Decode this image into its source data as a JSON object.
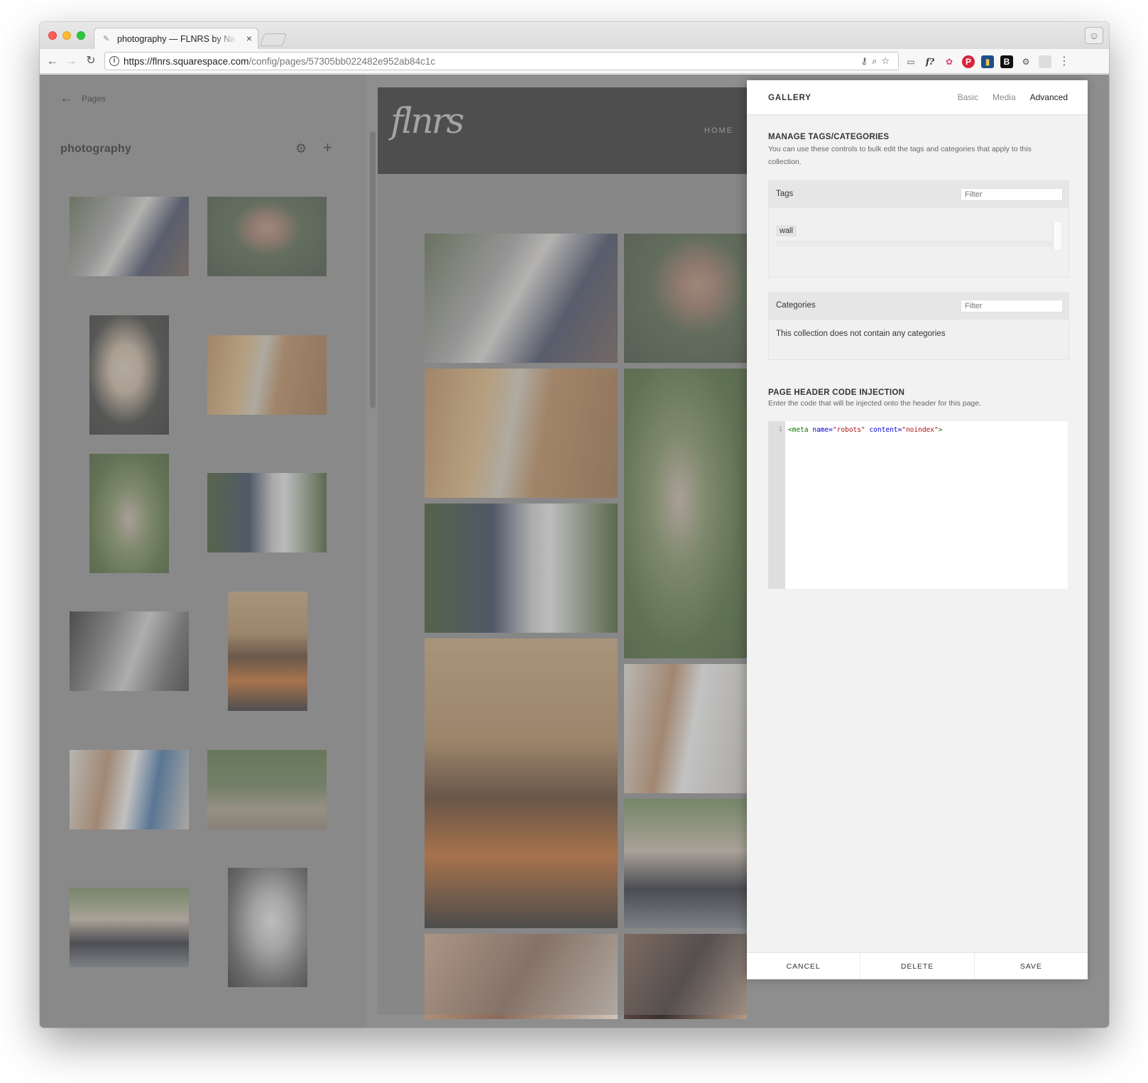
{
  "browser": {
    "tab_title": "photography — FLNRS by Na",
    "url_host": "https://flnrs.squarespace.com",
    "url_path": "/config/pages/57305bb022482e952ab84c1c"
  },
  "left_panel": {
    "back_label": "Pages",
    "title": "photography"
  },
  "preview": {
    "logo_text": "flnrs",
    "nav_home": "HOME"
  },
  "settings": {
    "title": "GALLERY",
    "tabs": [
      "Basic",
      "Media",
      "Advanced"
    ],
    "active_tab": "Advanced",
    "manage": {
      "heading": "MANAGE TAGS/CATEGORIES",
      "description": "You can use these controls to bulk edit the tags and categories that apply to this collection."
    },
    "tags": {
      "label": "Tags",
      "filter_placeholder": "Filter",
      "items": [
        "wall"
      ]
    },
    "categories": {
      "label": "Categories",
      "filter_placeholder": "Filter",
      "empty_text": "This collection does not contain any categories"
    },
    "injection": {
      "heading": "PAGE HEADER CODE INJECTION",
      "description": "Enter the code that will be injected onto the header for this page.",
      "line_number": "1",
      "code_tag_open": "<meta",
      "code_attr1": "name=",
      "code_val1": "\"robots\"",
      "code_attr2": "content=",
      "code_val2": "\"noindex\"",
      "code_tag_close": ">"
    },
    "footer": {
      "cancel": "CANCEL",
      "delete": "DELETE",
      "save": "SAVE"
    }
  },
  "colors": {
    "overlay_gray": "#8f8f8f",
    "panel_bg": "#f2f2f2",
    "site_header": "#2d2d2d"
  },
  "icons": [
    "info-icon",
    "back-arrow-icon",
    "reload-icon",
    "gear-icon",
    "plus-icon",
    "close-icon",
    "user-icon",
    "star-icon",
    "zoom-icon",
    "key-icon",
    "cast-icon"
  ]
}
